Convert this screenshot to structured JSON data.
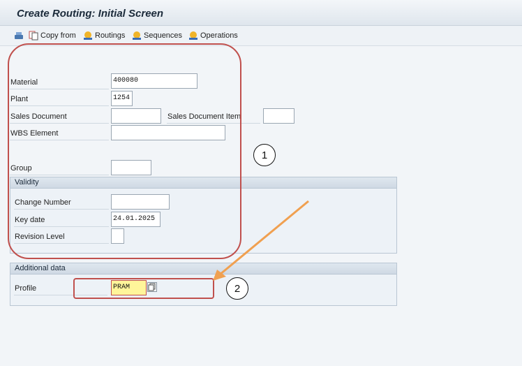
{
  "window": {
    "title": "Create Routing: Initial Screen"
  },
  "toolbar": {
    "copy_from": "Copy from",
    "routings": "Routings",
    "sequences": "Sequences",
    "operations": "Operations"
  },
  "fields": {
    "material": {
      "label": "Material",
      "value": "400080"
    },
    "plant": {
      "label": "Plant",
      "value": "1254"
    },
    "sales_document": {
      "label": "Sales Document",
      "value": ""
    },
    "sales_document_item": {
      "label": "Sales Document Item",
      "value": ""
    },
    "wbs_element": {
      "label": "WBS Element",
      "value": ""
    },
    "group": {
      "label": "Group",
      "value": ""
    }
  },
  "validity": {
    "title": "Validity",
    "change_number": {
      "label": "Change Number",
      "value": ""
    },
    "key_date": {
      "label": "Key date",
      "value": "24.01.2025"
    },
    "revision_level": {
      "label": "Revision Level",
      "value": ""
    }
  },
  "additional": {
    "title": "Additional data",
    "profile": {
      "label": "Profile",
      "value": "PRAM"
    }
  },
  "annotations": {
    "one": "1",
    "two": "2"
  },
  "colors": {
    "annotation": "#c0504d",
    "arrow": "#f0a050",
    "highlight": "#fff59a"
  }
}
